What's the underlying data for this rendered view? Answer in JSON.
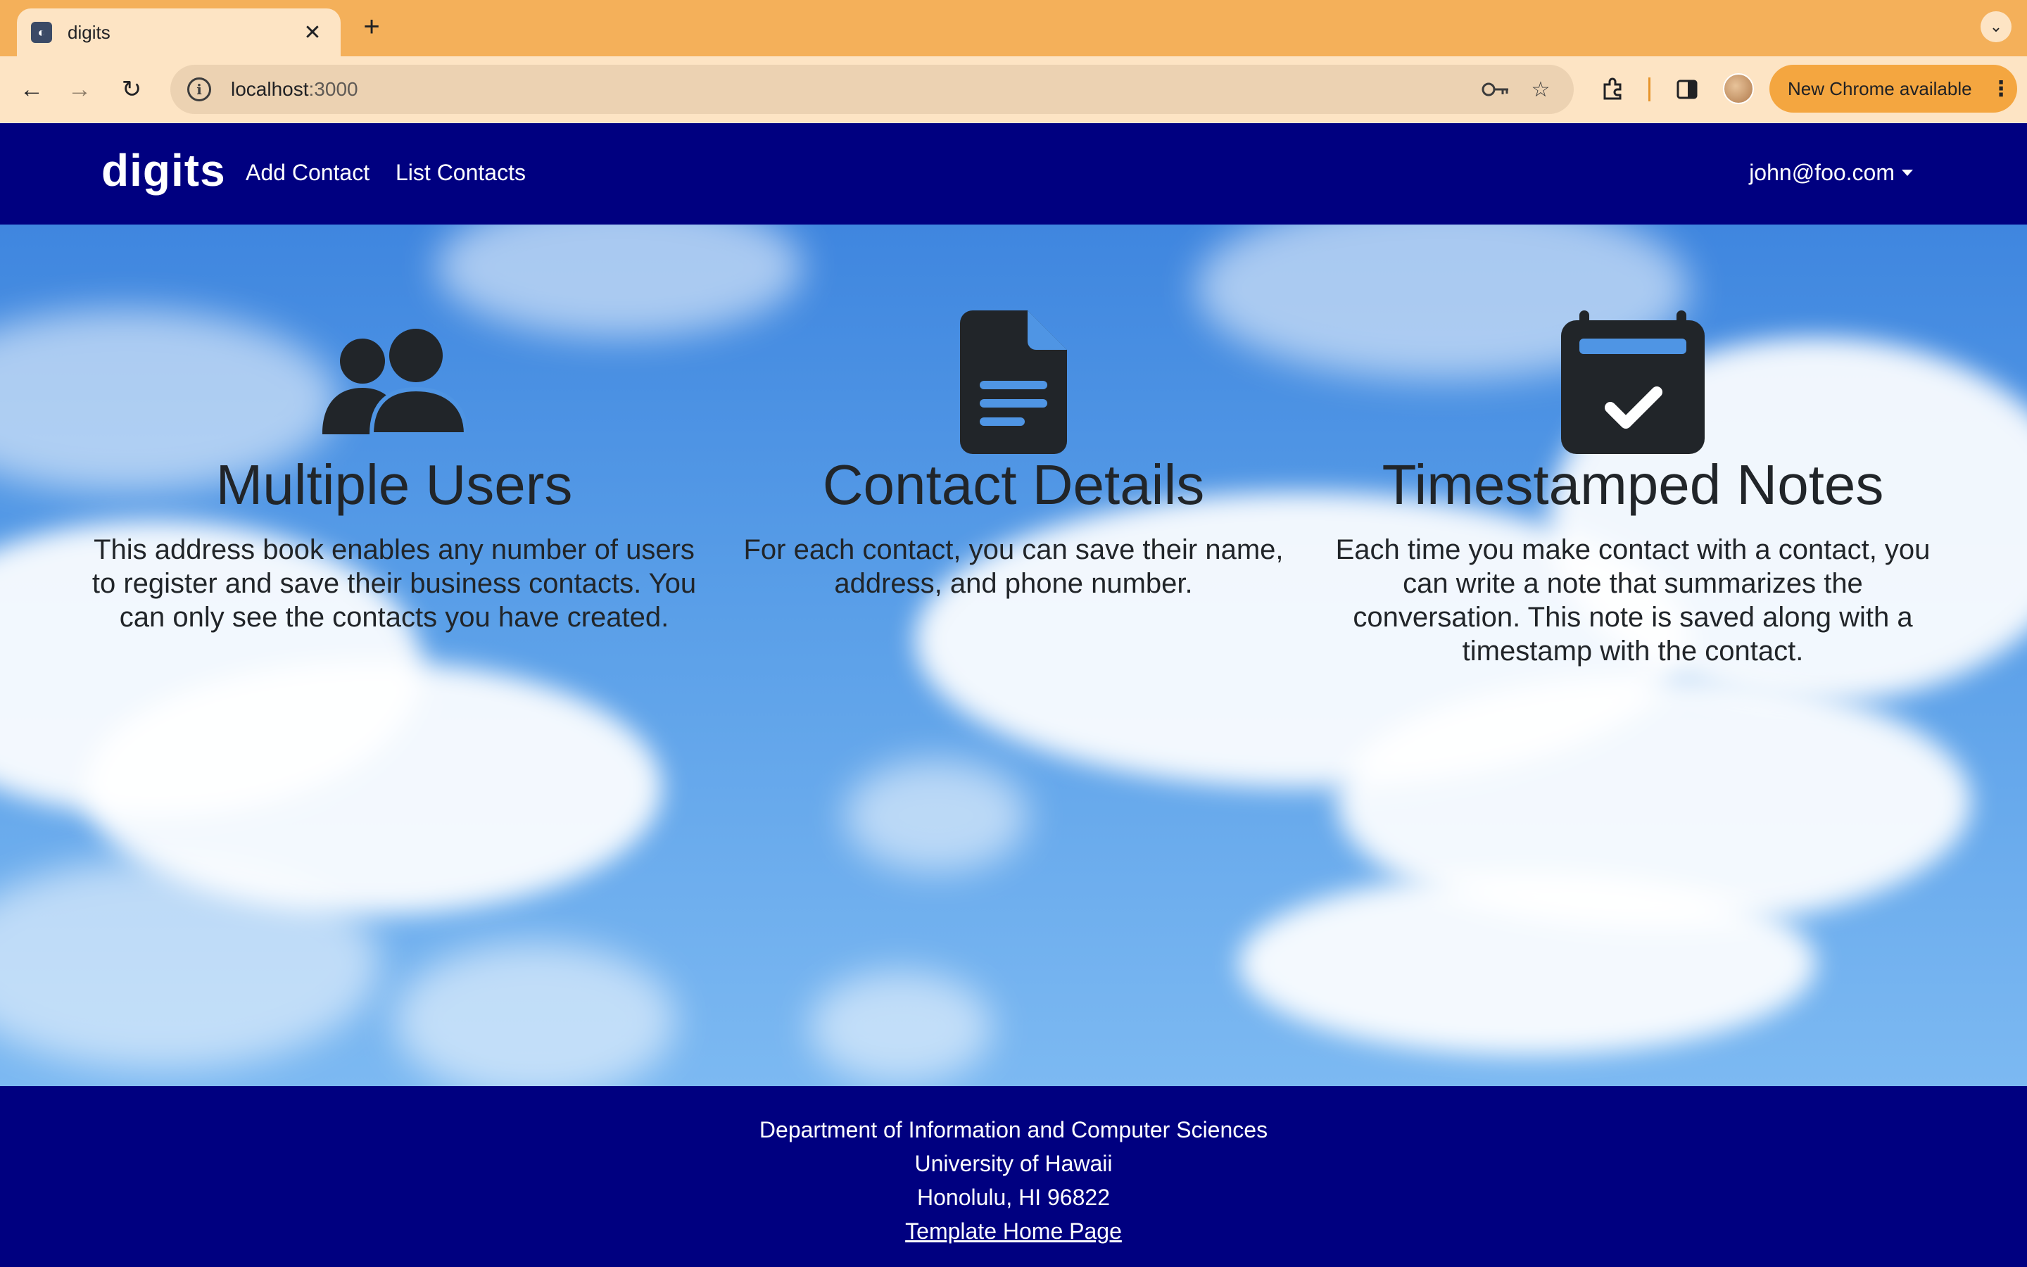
{
  "browser": {
    "tab_title": "digits",
    "tab_close": "✕",
    "new_tab": "+",
    "url_host": "localhost",
    "url_port": ":3000",
    "update_label": "New Chrome available"
  },
  "navbar": {
    "brand": "digits",
    "links": [
      "Add Contact",
      "List Contacts"
    ],
    "user": "john@foo.com"
  },
  "features": [
    {
      "icon": "users-icon",
      "title": "Multiple Users",
      "text": "This address book enables any number of users to register and save their business contacts. You can only see the contacts you have created."
    },
    {
      "icon": "file-document-icon",
      "title": "Contact Details",
      "text": "For each contact, you can save their name, address, and phone number."
    },
    {
      "icon": "calendar-check-icon",
      "title": "Timestamped Notes",
      "text": "Each time you make contact with a contact, you can write a note that summarizes the conversation. This note is saved along with a timestamp with the contact."
    }
  ],
  "footer": {
    "lines": [
      "Department of Information and Computer Sciences",
      "University of Hawaii",
      "Honolulu, HI 96822"
    ],
    "link": "Template Home Page"
  },
  "colors": {
    "navbar": "#000080",
    "icon": "#212529",
    "tabstrip": "#f4b05a",
    "toolbar": "#fde4c4"
  }
}
